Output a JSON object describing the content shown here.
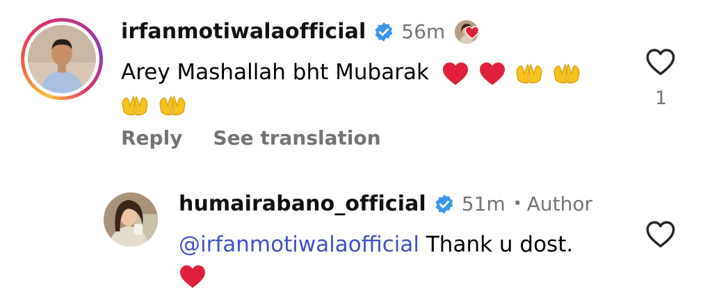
{
  "comment": {
    "username": "irfanmotiwalaofficial",
    "time": "56m",
    "text": "Arey Mashallah bht Mubarak",
    "like_count": "1",
    "reply_label": "Reply",
    "see_translation_label": "See translation"
  },
  "reply": {
    "username": "humairabano_official",
    "time": "51m",
    "separator": "•",
    "author_tag": "Author",
    "mention": "@irfanmotiwalaofficial",
    "text": "Thank u dost."
  },
  "colors": {
    "verified_badge": "#3897f0",
    "mention": "#4150c8",
    "muted_text": "#737373",
    "heart_emoji": "#e0203a"
  },
  "icons": {
    "verified": "verified-badge-icon",
    "like": "heart-outline-icon",
    "heart_emoji": "red-heart-emoji",
    "hands_emoji": "palms-up-together-emoji"
  }
}
